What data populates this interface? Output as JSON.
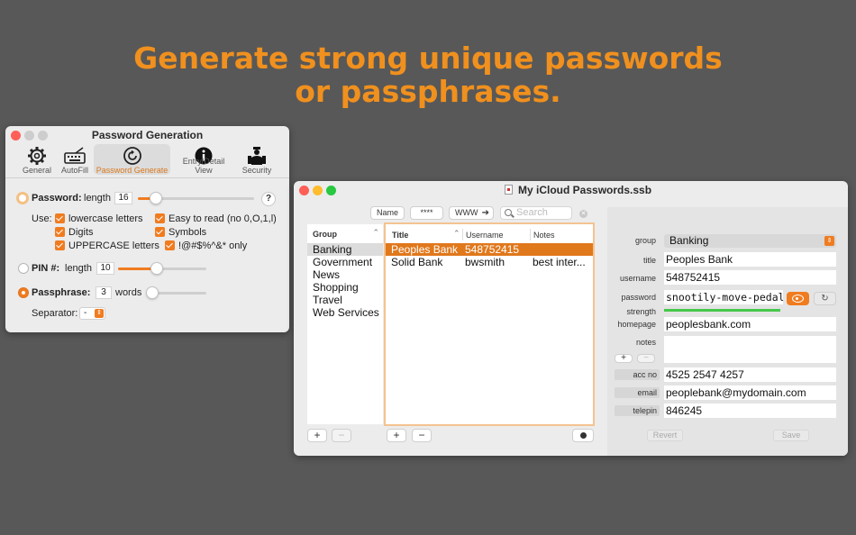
{
  "headline": {
    "line1": "Generate strong unique passwords",
    "line2": "or passphrases."
  },
  "gen_window": {
    "title": "Password Generation",
    "tabs": [
      {
        "label": "General",
        "icon": "gear-icon"
      },
      {
        "label": "AutoFill",
        "icon": "keyboard-icon"
      },
      {
        "label": "Password Generate",
        "icon": "refresh-icon"
      },
      {
        "label": "Entry/Detail View",
        "icon": "info-icon"
      },
      {
        "label": "Security",
        "icon": "guard-icon"
      }
    ],
    "password": {
      "label": "Password:",
      "length_label": "length",
      "length": "16",
      "help": "?",
      "slider_fraction": 0.12
    },
    "use_label": "Use:",
    "options": [
      {
        "label": "lowercase letters",
        "checked": true
      },
      {
        "label": "Easy to read (no 0,O,1,l)",
        "checked": true
      },
      {
        "label": "Digits",
        "checked": true
      },
      {
        "label": "Symbols",
        "checked": true
      },
      {
        "label": "UPPERCASE letters",
        "checked": true
      },
      {
        "label": "!@#$%^&* only",
        "checked": true
      }
    ],
    "pin": {
      "label": "PIN #:",
      "length_label": "length",
      "length": "10",
      "slider_fraction": 0.39
    },
    "passphrase": {
      "label": "Passphrase:",
      "words": "3",
      "words_label": "words",
      "slider_fraction": 0.0
    },
    "separator": {
      "label": "Separator:",
      "value": "-"
    }
  },
  "main_window": {
    "title": "My iCloud Passwords.ssb",
    "toolbar": {
      "name": "Name",
      "stars": "****",
      "www": "WWW",
      "search_placeholder": "Search"
    },
    "groups": {
      "header": "Group",
      "items": [
        "Banking",
        "Government",
        "News",
        "Shopping",
        "Travel",
        "Web Services"
      ],
      "selected": 0
    },
    "entries": {
      "headers": [
        "Title",
        "Username",
        "Notes"
      ],
      "rows": [
        {
          "title": "Peoples Bank",
          "username": "548752415",
          "notes": ""
        },
        {
          "title": "Solid Bank",
          "username": "bwsmith",
          "notes": "best inter..."
        }
      ],
      "selected": 0
    },
    "detail": {
      "group_label": "group",
      "group_value": "Banking",
      "title_label": "title",
      "title_value": "Peoples Bank",
      "username_label": "username",
      "username_value": "548752415",
      "password_label": "password",
      "password_value": "snootily-move-pedal",
      "strength_label": "strength",
      "strength_fraction": 0.73,
      "homepage_label": "homepage",
      "homepage_value": "peoplesbank.com",
      "notes_label": "notes",
      "notes_value": "",
      "custom": [
        {
          "label": "acc no",
          "value": "4525 2547 4257"
        },
        {
          "label": "email",
          "value": "peoplebank@mydomain.com"
        },
        {
          "label": "telepin",
          "value": "846245"
        }
      ],
      "revert": "Revert",
      "save": "Save"
    }
  },
  "colors": {
    "accent": "#f07c20",
    "headline": "#f0901e",
    "selection": "#e0781c",
    "strength": "#46c84a"
  }
}
